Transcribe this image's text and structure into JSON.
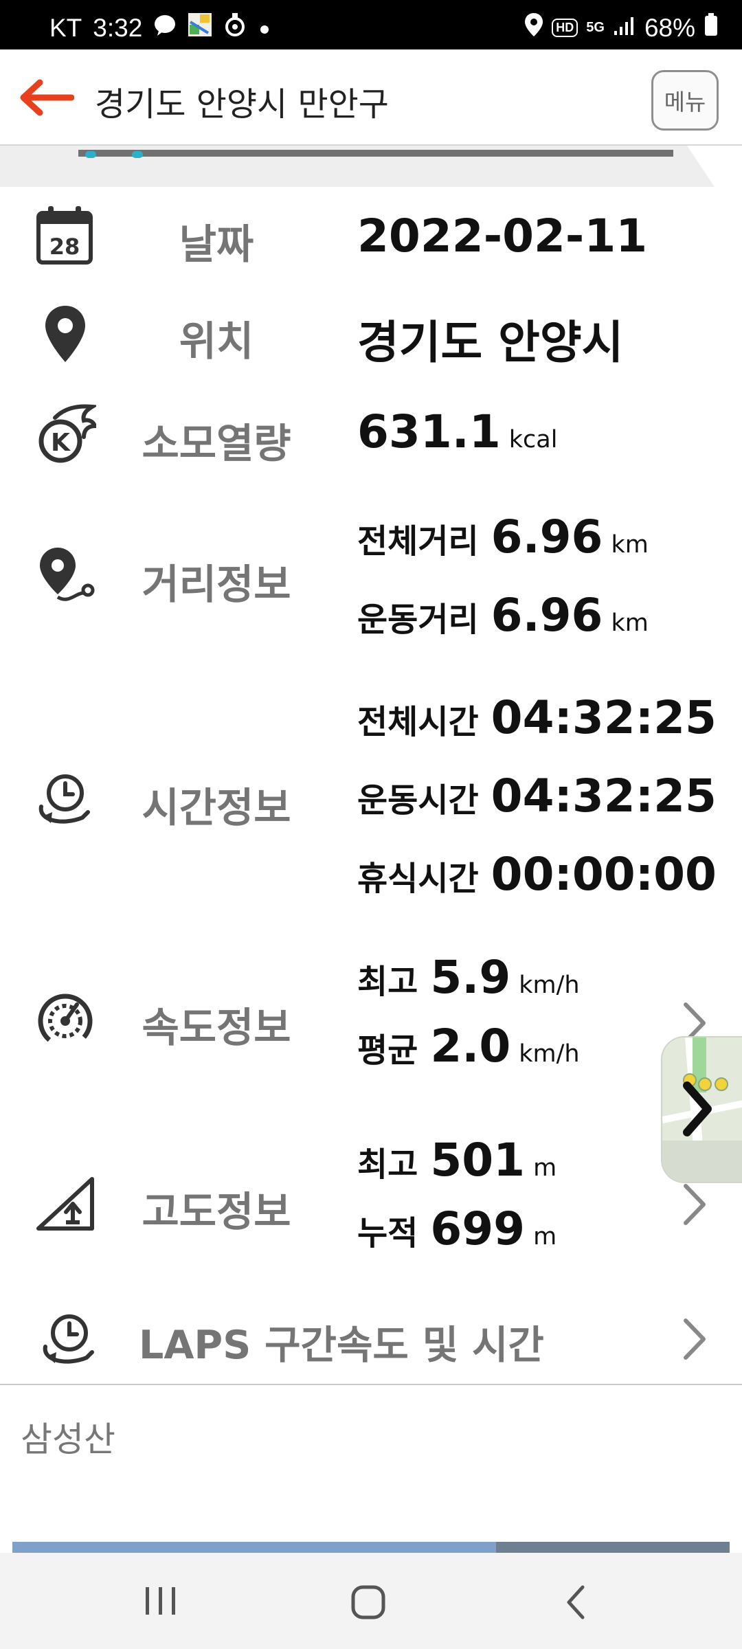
{
  "status_bar": {
    "carrier": "KT",
    "time": "3:32",
    "battery": "68%",
    "hd_badge": "HD",
    "network_badge": "5G",
    "left_icons": [
      "chat-bubble-icon",
      "app-thumbnail-icon",
      "cycling-app-icon",
      "notification-dot-icon"
    ],
    "right_icons": [
      "location-pin-icon",
      "hd-voice-icon",
      "5g-icon",
      "signal-icon",
      "battery-icon"
    ]
  },
  "header": {
    "title": "경기도 안양시 만안구",
    "menu_label": "메뉴",
    "back_icon": "back-arrow-icon",
    "accent_color": "#e8401c"
  },
  "rows": {
    "date": {
      "label": "날짜",
      "value": "2022-02-11",
      "icon": "calendar-icon",
      "calendar_day": "28"
    },
    "location": {
      "label": "위치",
      "value": "경기도 안양시",
      "icon": "location-pin-icon"
    },
    "calories": {
      "label": "소모열량",
      "value": "631.1",
      "unit": "kcal",
      "icon": "calorie-flame-icon",
      "icon_letter": "K"
    },
    "distance": {
      "label": "거리정보",
      "icon": "distance-route-icon",
      "total_label": "전체거리",
      "total_value": "6.96",
      "total_unit": "km",
      "exercise_label": "운동거리",
      "exercise_value": "6.96",
      "exercise_unit": "km"
    },
    "time": {
      "label": "시간정보",
      "icon": "clock-cycle-icon",
      "total_label": "전체시간",
      "total_value": "04:32:25",
      "exercise_label": "운동시간",
      "exercise_value": "04:32:25",
      "rest_label": "휴식시간",
      "rest_value": "00:00:00"
    },
    "speed": {
      "label": "속도정보",
      "icon": "speedometer-icon",
      "max_label": "최고",
      "max_value": "5.9",
      "max_unit": "km/h",
      "avg_label": "평균",
      "avg_value": "2.0",
      "avg_unit": "km/h"
    },
    "altitude": {
      "label": "고도정보",
      "icon": "altitude-slope-icon",
      "max_label": "최고",
      "max_value": "501",
      "max_unit": "m",
      "cumulative_label": "누적",
      "cumulative_value": "699",
      "cumulative_unit": "m"
    },
    "laps": {
      "label": "LAPS 구간속도 및 시간",
      "icon": "laps-clock-icon"
    }
  },
  "note": {
    "text": "삼성산"
  },
  "floating_map": {
    "icon": "map-thumbnail-icon",
    "arrow_icon": "chevron-right-icon"
  },
  "nav_bar": {
    "icons": [
      "recent-apps-icon",
      "home-icon",
      "back-nav-icon"
    ]
  }
}
